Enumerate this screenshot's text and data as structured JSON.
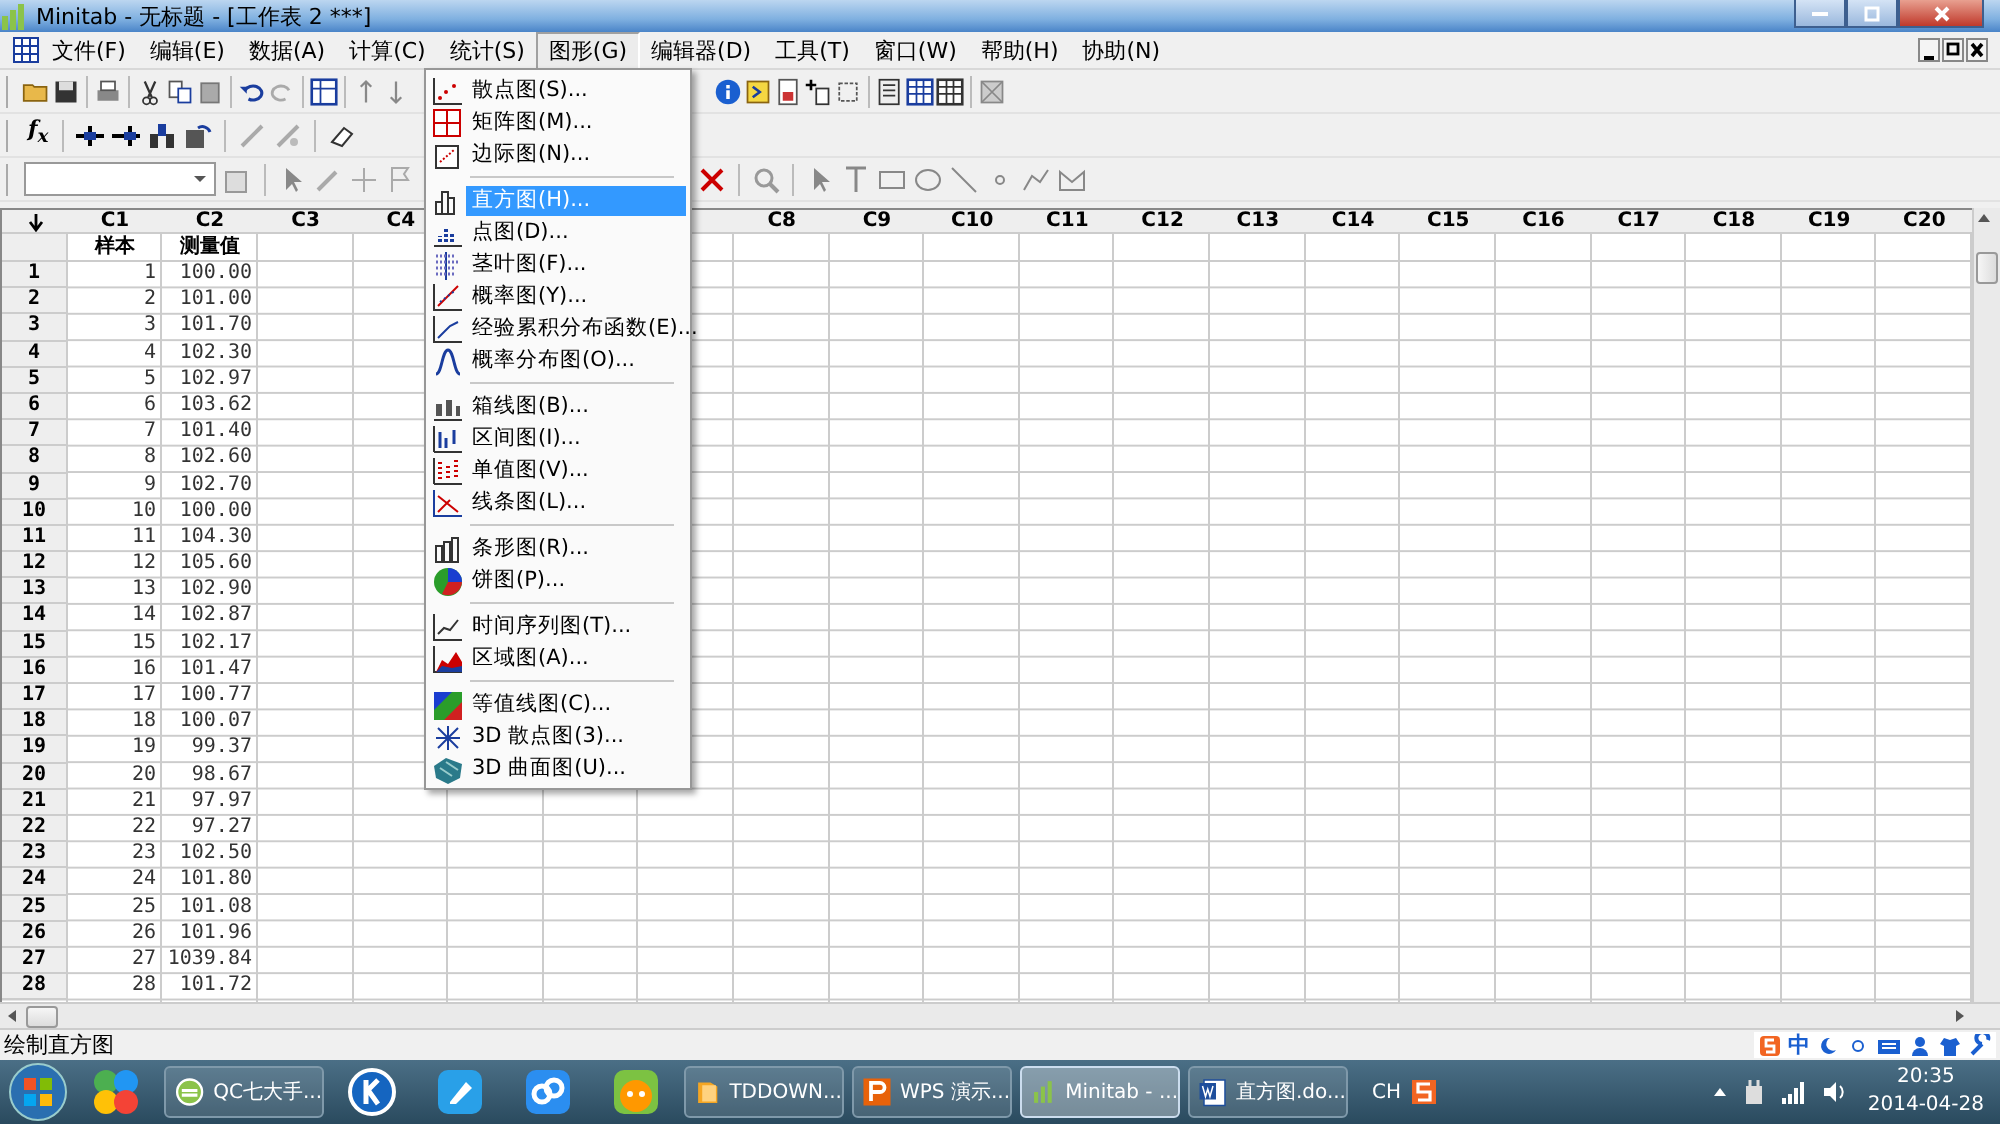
{
  "window": {
    "title": "Minitab - 无标题 - [工作表 2 ***]"
  },
  "menu_bar": [
    {
      "label": "文件(F)",
      "selected": false
    },
    {
      "label": "编辑(E)",
      "selected": false
    },
    {
      "label": "数据(A)",
      "selected": false
    },
    {
      "label": "计算(C)",
      "selected": false
    },
    {
      "label": "统计(S)",
      "selected": false
    },
    {
      "label": "图形(G)",
      "selected": true
    },
    {
      "label": "编辑器(D)",
      "selected": false
    },
    {
      "label": "工具(T)",
      "selected": false
    },
    {
      "label": "窗口(W)",
      "selected": false
    },
    {
      "label": "帮助(H)",
      "selected": false
    },
    {
      "label": "协助(N)",
      "selected": false
    }
  ],
  "function_button": {
    "label": "f$_{x}$"
  },
  "graph_menu": {
    "groups": [
      [
        {
          "label": "散点图(S)...",
          "selected": false
        },
        {
          "label": "矩阵图(M)...",
          "selected": false
        },
        {
          "label": "边际图(N)...",
          "selected": false
        }
      ],
      [
        {
          "label": "直方图(H)...",
          "selected": true
        },
        {
          "label": "点图(D)...",
          "selected": false
        },
        {
          "label": "茎叶图(F)...",
          "selected": false
        },
        {
          "label": "概率图(Y)...",
          "selected": false
        },
        {
          "label": "经验累积分布函数(E)...",
          "selected": false
        },
        {
          "label": "概率分布图(O)...",
          "selected": false
        }
      ],
      [
        {
          "label": "箱线图(B)...",
          "selected": false
        },
        {
          "label": "区间图(I)...",
          "selected": false
        },
        {
          "label": "单值图(V)...",
          "selected": false
        },
        {
          "label": "线条图(L)...",
          "selected": false
        }
      ],
      [
        {
          "label": "条形图(R)...",
          "selected": false
        },
        {
          "label": "饼图(P)...",
          "selected": false
        }
      ],
      [
        {
          "label": "时间序列图(T)...",
          "selected": false
        },
        {
          "label": "区域图(A)...",
          "selected": false
        }
      ],
      [
        {
          "label": "等值线图(C)...",
          "selected": false
        },
        {
          "label": "3D 散点图(3)...",
          "selected": false
        },
        {
          "label": "3D 曲面图(U)...",
          "selected": false
        }
      ]
    ]
  },
  "worksheet": {
    "columns": [
      {
        "label": "C1",
        "name": "样本"
      },
      {
        "label": "C2",
        "name": "测量值"
      },
      {
        "label": "C3"
      },
      {
        "label": "C4"
      },
      {},
      {},
      {},
      {
        "label": "C8"
      },
      {
        "label": "C9"
      },
      {
        "label": "C10"
      },
      {
        "label": "C11"
      },
      {
        "label": "C12"
      },
      {
        "label": "C13"
      },
      {
        "label": "C14"
      },
      {
        "label": "C15"
      },
      {
        "label": "C16"
      },
      {
        "label": "C17"
      },
      {
        "label": "C18"
      },
      {
        "label": "C19"
      },
      {
        "label": "C20"
      }
    ],
    "rows": [
      {
        "label": "1",
        "cells": [
          "1",
          "100.00"
        ]
      },
      {
        "label": "2",
        "cells": [
          "2",
          "101.00"
        ]
      },
      {
        "label": "3",
        "cells": [
          "3",
          "101.70"
        ]
      },
      {
        "label": "4",
        "cells": [
          "4",
          "102.30"
        ]
      },
      {
        "label": "5",
        "cells": [
          "5",
          "102.97"
        ]
      },
      {
        "label": "6",
        "cells": [
          "6",
          "103.62"
        ]
      },
      {
        "label": "7",
        "cells": [
          "7",
          "101.40"
        ]
      },
      {
        "label": "8",
        "cells": [
          "8",
          "102.60"
        ]
      },
      {
        "label": "9",
        "cells": [
          "9",
          "102.70"
        ]
      },
      {
        "label": "10",
        "cells": [
          "10",
          "100.00"
        ]
      },
      {
        "label": "11",
        "cells": [
          "11",
          "104.30"
        ]
      },
      {
        "label": "12",
        "cells": [
          "12",
          "105.60"
        ]
      },
      {
        "label": "13",
        "cells": [
          "13",
          "102.90"
        ]
      },
      {
        "label": "14",
        "cells": [
          "14",
          "102.87"
        ]
      },
      {
        "label": "15",
        "cells": [
          "15",
          "102.17"
        ]
      },
      {
        "label": "16",
        "cells": [
          "16",
          "101.47"
        ]
      },
      {
        "label": "17",
        "cells": [
          "17",
          "100.77"
        ]
      },
      {
        "label": "18",
        "cells": [
          "18",
          "100.07"
        ]
      },
      {
        "label": "19",
        "cells": [
          "19",
          "99.37"
        ]
      },
      {
        "label": "20",
        "cells": [
          "20",
          "98.67"
        ]
      },
      {
        "label": "21",
        "cells": [
          "21",
          "97.97"
        ]
      },
      {
        "label": "22",
        "cells": [
          "22",
          "97.27"
        ]
      },
      {
        "label": "23",
        "cells": [
          "23",
          "102.50"
        ]
      },
      {
        "label": "24",
        "cells": [
          "24",
          "101.80"
        ]
      },
      {
        "label": "25",
        "cells": [
          "25",
          "101.08"
        ]
      },
      {
        "label": "26",
        "cells": [
          "26",
          "101.96"
        ]
      },
      {
        "label": "27",
        "cells": [
          "27",
          "1039.84"
        ]
      },
      {
        "label": "28",
        "cells": [
          "28",
          "101.72"
        ]
      }
    ]
  },
  "status_bar": {
    "text": "绘制直方图"
  },
  "ime_bar": {
    "mode": "中"
  },
  "taskbar": {
    "items": [
      {
        "kind": "pinned"
      },
      {
        "kind": "task",
        "label": "QC七大手...",
        "selected": false
      },
      {
        "kind": "pinned"
      },
      {
        "kind": "pinned"
      },
      {
        "kind": "pinned"
      },
      {
        "kind": "pinned"
      },
      {
        "kind": "task",
        "label": "TDDOWN...",
        "selected": false
      },
      {
        "kind": "task",
        "label": "WPS 演示...",
        "selected": false
      },
      {
        "kind": "task",
        "label": "Minitab - ...",
        "selected": true
      },
      {
        "kind": "task",
        "label": "直方图.do...",
        "selected": false
      }
    ],
    "language": "CH",
    "time": "20:35",
    "date": "2014-04-28"
  }
}
